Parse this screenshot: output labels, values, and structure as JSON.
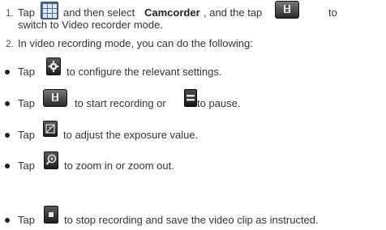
{
  "steps": [
    {
      "number": "1.",
      "parts": [
        "Tap",
        "and then select",
        "Camcorder",
        ", and the tap",
        "to"
      ],
      "continuation": "switch to Video recorder mode."
    },
    {
      "number": "2.",
      "text": "In video recording mode, you can do the following:"
    }
  ],
  "bullets": [
    {
      "tap": "Tap",
      "text": "to configure the relevant settings.",
      "icon": "settings-gear-icon"
    },
    {
      "tap": "Tap",
      "text": "to start recording or",
      "text2": "to pause.",
      "icon": "record-icon",
      "icon2": "pause-icon"
    },
    {
      "tap": "Tap",
      "text": "to adjust the exposure value.",
      "icon": "exposure-icon"
    },
    {
      "tap": "Tap",
      "text": "to zoom in or zoom out.",
      "icon": "zoom-icon"
    },
    {
      "tap": "Tap",
      "text": "to stop recording and save the video clip as instructed.",
      "icon": "stop-icon"
    }
  ],
  "colors": {
    "text": "#333333",
    "icon_blue": "#4d6f95",
    "icon_dark": "#1f1f1f",
    "icon_red": "#d83a2a"
  }
}
